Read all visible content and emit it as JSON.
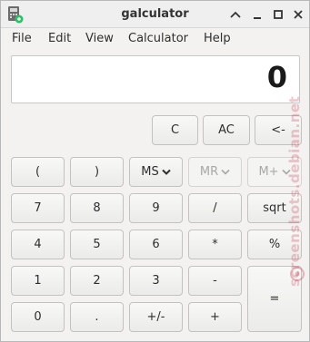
{
  "window": {
    "title": "galculator"
  },
  "menubar": {
    "items": [
      "File",
      "Edit",
      "View",
      "Calculator",
      "Help"
    ]
  },
  "display": {
    "value": "0"
  },
  "buttons": {
    "c": "C",
    "ac": "AC",
    "backspace": "<-",
    "paren_open": "(",
    "paren_close": ")",
    "ms": "MS",
    "mr": "MR",
    "mplus": "M+",
    "seven": "7",
    "eight": "8",
    "nine": "9",
    "divide": "/",
    "sqrt": "sqrt",
    "four": "4",
    "five": "5",
    "six": "6",
    "multiply": "*",
    "percent": "%",
    "one": "1",
    "two": "2",
    "three": "3",
    "minus": "-",
    "equals": "=",
    "zero": "0",
    "point": ".",
    "sign": "+/-",
    "plus": "+"
  },
  "watermark": {
    "text": "screenshots.debian.net"
  }
}
